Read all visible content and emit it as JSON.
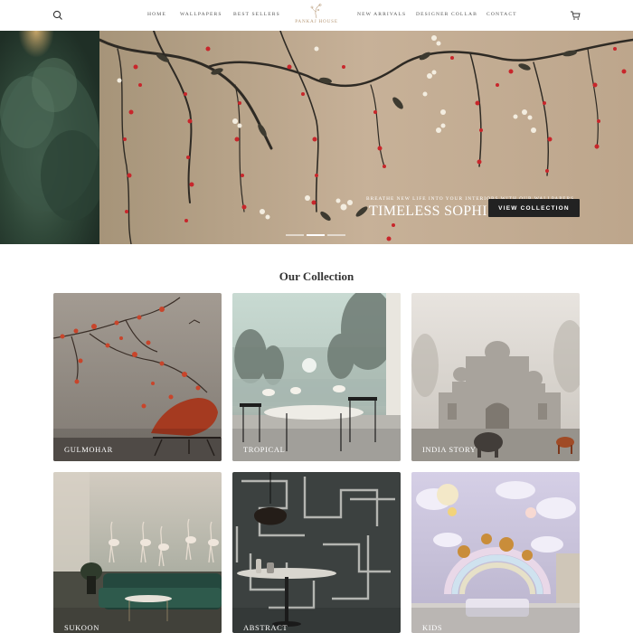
{
  "header": {
    "nav_left": [
      "HOME",
      "WALLPAPERS",
      "BEST SELLERS"
    ],
    "logo_text": "PANKAJ HOUSE",
    "nav_right": [
      "NEW ARRIVALS",
      "DESIGNER COLLAB",
      "CONTACT"
    ]
  },
  "hero": {
    "subtitle": "BREATHE NEW LIFE INTO YOUR INTERIORS WITH OUR WALLPAPERS",
    "title": "TIMELESS SOPHISTICATION",
    "button_label": "VIEW COLLECTION",
    "slides_count": 3,
    "active_slide": 2
  },
  "collection": {
    "title": "Our Collection",
    "items": [
      {
        "label": "GULMOHAR"
      },
      {
        "label": "TROPICAL"
      },
      {
        "label": "INDIA STORY"
      },
      {
        "label": "SUKOON"
      },
      {
        "label": "ABSTRACT"
      },
      {
        "label": "KIDS"
      }
    ]
  },
  "colors": {
    "button_bg": "#222222",
    "logo": "#b89a78",
    "blossom": "#c8262b"
  }
}
